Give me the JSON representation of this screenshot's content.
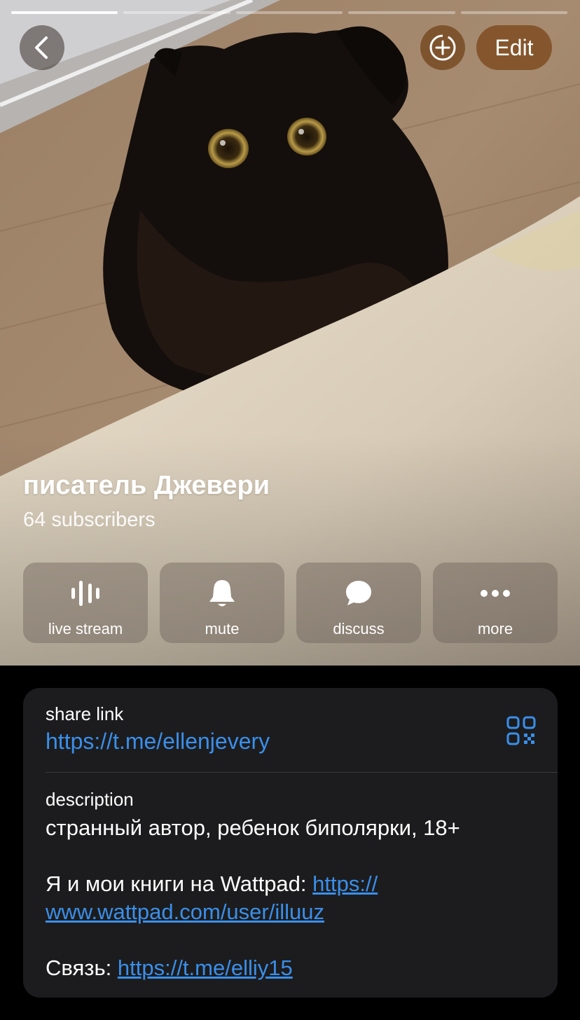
{
  "header": {
    "edit_label": "Edit"
  },
  "profile": {
    "title": "писатель Джевери",
    "subscribers": "64 subscribers"
  },
  "actions": [
    {
      "label": "live stream",
      "icon": "live-stream-icon"
    },
    {
      "label": "mute",
      "icon": "bell-icon"
    },
    {
      "label": "discuss",
      "icon": "chat-bubble-icon"
    },
    {
      "label": "more",
      "icon": "more-dots-icon"
    }
  ],
  "info": {
    "share_label": "share link",
    "share_url": "https://t.me/ellenjevery",
    "description_label": "description",
    "description_line1": "странный автор, ребенок биполярки, 18+",
    "wattpad_prefix": "Я и мои книги на Wattpad: ",
    "wattpad_url": "https://www.wattpad.com/user/illuuz",
    "wattpad_url_part1": "https://",
    "wattpad_url_part2": "www.wattpad.com/user/illuuz",
    "contact_prefix": "Связь: ",
    "contact_url": "https://t.me/elliy15"
  },
  "colors": {
    "link": "#3a8fea",
    "card_bg": "#1c1c1e",
    "edit_bg": "#82502a"
  }
}
